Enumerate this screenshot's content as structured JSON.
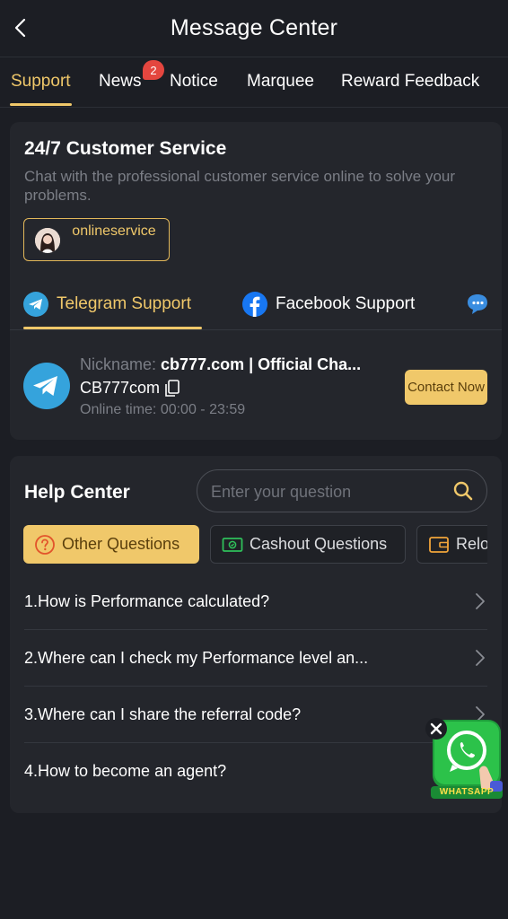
{
  "header": {
    "title": "Message Center"
  },
  "tabs": [
    {
      "label": "Support"
    },
    {
      "label": "News",
      "badge": "2"
    },
    {
      "label": "Notice"
    },
    {
      "label": "Marquee"
    },
    {
      "label": "Reward Feedback"
    }
  ],
  "customer_service": {
    "title": "24/7 Customer Service",
    "description": "Chat with the professional customer service online to solve your problems.",
    "online_button": "onlineservice",
    "channels": [
      {
        "label": "Telegram Support",
        "icon": "telegram-icon"
      },
      {
        "label": "Facebook Support",
        "icon": "facebook-icon"
      },
      {
        "label": "",
        "icon": "chat-icon"
      }
    ],
    "contact": {
      "nickname_label": "Nickname:",
      "nickname_value": "cb777.com | Official Cha...",
      "account": "CB777com",
      "online_time": "Online time: 00:00 - 23:59",
      "button": "Contact Now"
    }
  },
  "help_center": {
    "title": "Help Center",
    "search_placeholder": "Enter your question",
    "categories": [
      {
        "label": "Other Questions",
        "icon": "question-icon"
      },
      {
        "label": "Cashout Questions",
        "icon": "cashout-icon"
      },
      {
        "label": "Relo",
        "icon": "wallet-icon"
      }
    ],
    "faqs": [
      "1.How is Performance calculated?",
      "2.Where can I check my Performance level an...",
      "3.Where can I share the referral code?",
      "4.How to become an agent?"
    ]
  },
  "whatsapp": {
    "label": "WHATSAPP"
  },
  "colors": {
    "accent": "#f0c86a",
    "background": "#1c1e24",
    "card": "#24262c",
    "badge": "#e4463f"
  }
}
